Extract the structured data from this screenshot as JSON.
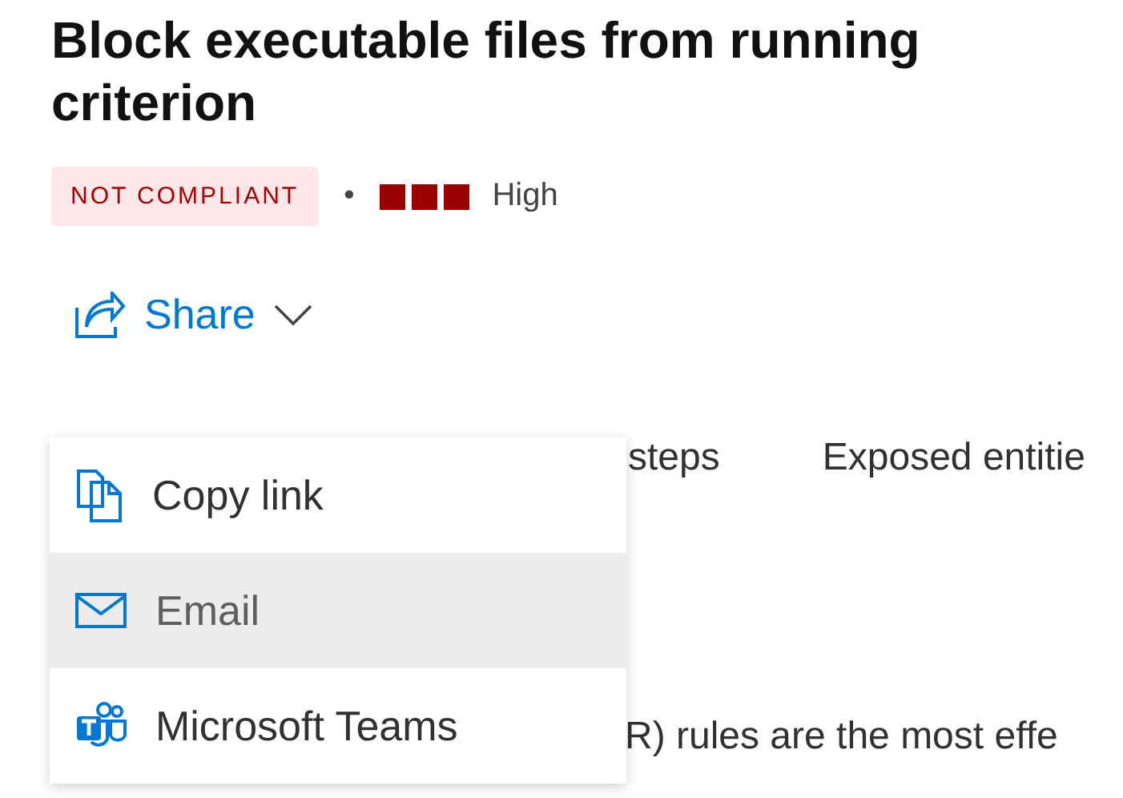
{
  "title": "Block executable files from running criterion",
  "status_badge": "NOT COMPLIANT",
  "separator": "•",
  "severity": "High",
  "share": {
    "label": "Share",
    "expanded": true
  },
  "share_menu": [
    {
      "kind": "copy",
      "label": "Copy link",
      "selected": false
    },
    {
      "kind": "email",
      "label": "Email",
      "selected": true
    },
    {
      "kind": "teams",
      "label": "Microsoft Teams",
      "selected": false
    }
  ],
  "tabs": [
    {
      "label": "steps"
    },
    {
      "label": "Exposed entitie"
    }
  ],
  "description": "R) rules are the most effe"
}
